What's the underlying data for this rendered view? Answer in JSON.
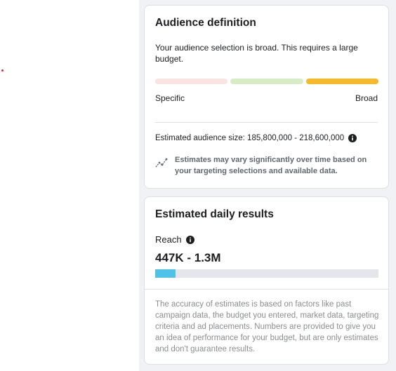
{
  "audience_card": {
    "title": "Audience definition",
    "description": "Your audience selection is broad. This requires a large budget.",
    "meter": {
      "level": "broad",
      "segment_colors": [
        "#fbe3e1",
        "#d7ecc4",
        "#f7b928"
      ]
    },
    "specific_label": "Specific",
    "broad_label": "Broad",
    "estimated_size": "Estimated audience size: 185,800,000 - 218,600,000",
    "note_icon": "trend-icon",
    "note": "Estimates may vary significantly over time based on your targeting selections and available data."
  },
  "results_card": {
    "title": "Estimated daily results",
    "reach_label": "Reach",
    "reach_value": "447K - 1.3M",
    "reach_fill_fraction": 0.09,
    "reach_fill_color": "#4ec2e8",
    "disclaimer": "The accuracy of estimates is based on factors like past campaign data, the budget you entered, market data, targeting criteria and ad placements. Numbers are provided to give you an idea of performance for your budget, but are only estimates and don't guarantee results."
  }
}
